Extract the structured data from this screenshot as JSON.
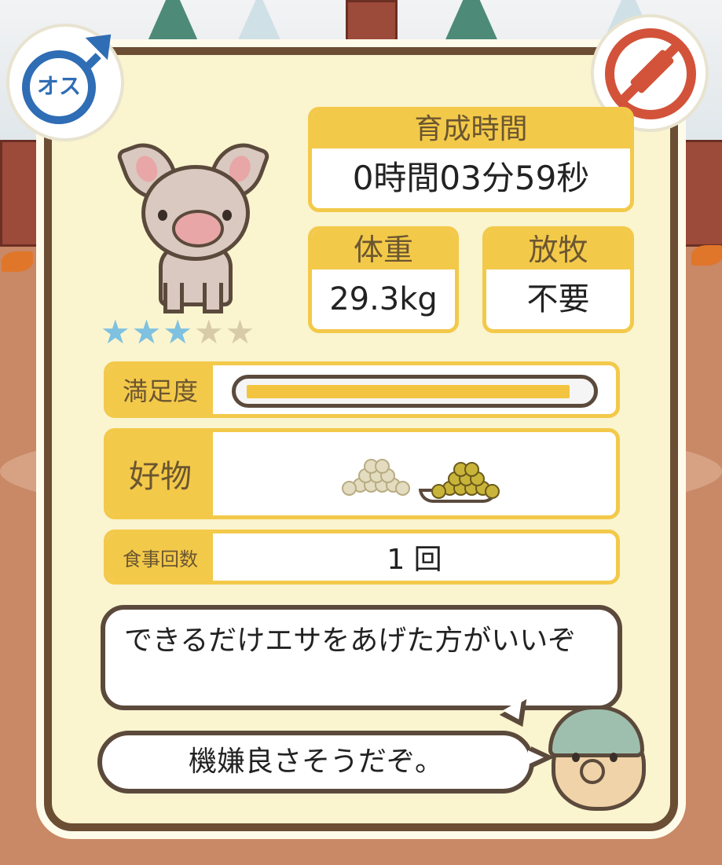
{
  "badges": {
    "gender_label": "オス",
    "gender_icon": "male-icon",
    "status_icon": "no-medicine-icon"
  },
  "rating": {
    "value": 3,
    "max": 5
  },
  "growth_time": {
    "label": "育成時間",
    "value": "0時間03分59秒"
  },
  "weight": {
    "label": "体重",
    "value": "29.3kg"
  },
  "grazing": {
    "label": "放牧",
    "value": "不要"
  },
  "satisfaction": {
    "label": "満足度",
    "level": 0.96
  },
  "favorite": {
    "label": "好物",
    "items": [
      "grain-pile-icon",
      "grain-plate-icon"
    ]
  },
  "meals": {
    "label": "食事回数",
    "value": "1 回"
  },
  "speech": {
    "advice": "できるだけエサをあげた方がいいぞ",
    "mood": "機嫌良さそうだぞ。"
  },
  "colors": {
    "accent": "#f3c94a",
    "frame": "#6b4e34",
    "panel": "#faf4cf",
    "male": "#2f6db5",
    "no_med": "#d2533a",
    "star_on": "#7ec1e0"
  }
}
